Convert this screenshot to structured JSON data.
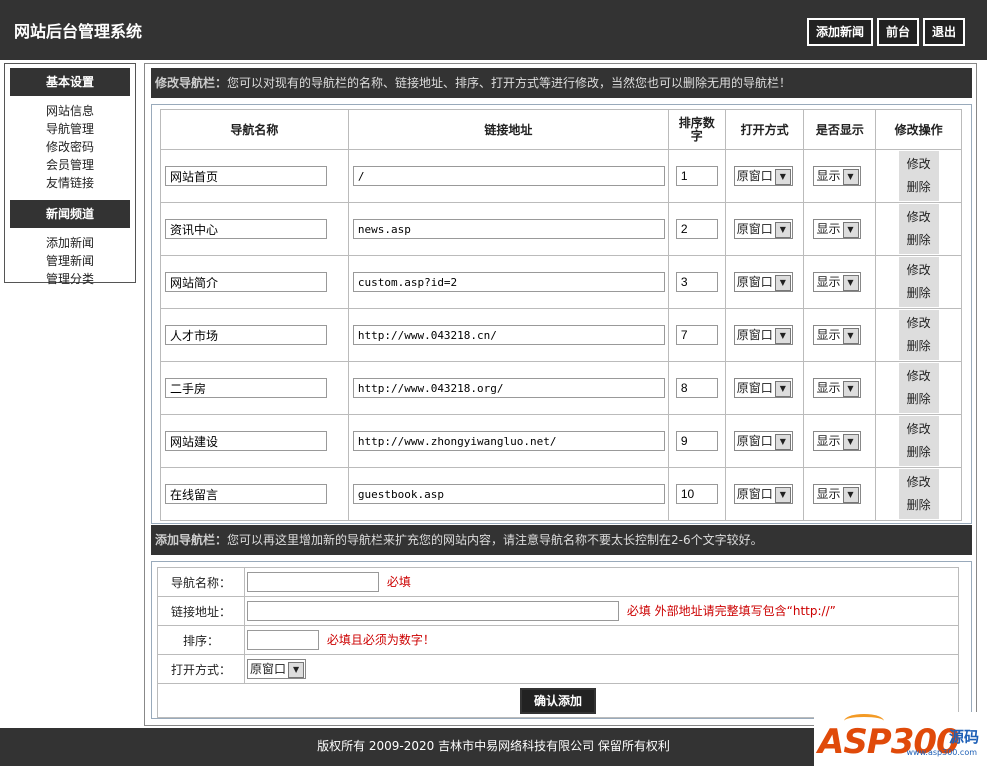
{
  "header": {
    "title": "网站后台管理系统",
    "buttons": [
      "添加新闻",
      "前台",
      "退出"
    ]
  },
  "sidebar": {
    "sections": [
      {
        "title": "基本设置",
        "items": [
          "网站信息",
          "导航管理",
          "修改密码",
          "会员管理",
          "友情链接"
        ]
      },
      {
        "title": "新闻频道",
        "items": [
          "添加新闻",
          "管理新闻",
          "管理分类"
        ]
      }
    ]
  },
  "edit_bar": {
    "label": "修改导航栏：",
    "text": "您可以对现有的导航栏的名称、链接地址、排序、打开方式等进行修改，当然您也可以删除无用的导航栏！"
  },
  "nav_table": {
    "headers": [
      "导航名称",
      "链接地址",
      "排序数字",
      "打开方式",
      "是否显示",
      "修改操作"
    ],
    "rows": [
      {
        "name": "网站首页",
        "url": "/",
        "order": "1",
        "open": "原窗口",
        "show": "显示"
      },
      {
        "name": "资讯中心",
        "url": "news.asp",
        "order": "2",
        "open": "原窗口",
        "show": "显示"
      },
      {
        "name": "网站简介",
        "url": "custom.asp?id=2",
        "order": "3",
        "open": "原窗口",
        "show": "显示"
      },
      {
        "name": "人才市场",
        "url": "http://www.043218.cn/",
        "order": "7",
        "open": "原窗口",
        "show": "显示"
      },
      {
        "name": "二手房",
        "url": "http://www.043218.org/",
        "order": "8",
        "open": "原窗口",
        "show": "显示"
      },
      {
        "name": "网站建设",
        "url": "http://www.zhongyiwangluo.net/",
        "order": "9",
        "open": "原窗口",
        "show": "显示"
      },
      {
        "name": "在线留言",
        "url": "guestbook.asp",
        "order": "10",
        "open": "原窗口",
        "show": "显示"
      }
    ],
    "edit_label": "修改",
    "delete_label": "删除"
  },
  "add_bar": {
    "label": "添加导航栏：",
    "text": "您可以再这里增加新的导航栏来扩充您的网站内容，请注意导航名称不要太长控制在2-6个文字较好。"
  },
  "add_form": {
    "name_label": "导航名称：",
    "name_hint": "必填",
    "url_label": "链接地址：",
    "url_hint": "必填 外部地址请完整填写包含“http://”",
    "order_label": "排序：",
    "order_hint": "必填且必须为数字！",
    "open_label": "打开方式：",
    "open_value": "原窗口",
    "submit_label": "确认添加"
  },
  "footer": {
    "text": "版权所有 2009-2020 吉林市中易网络科技有限公司 保留所有权利"
  },
  "watermark": {
    "brand": "ASP300",
    "tag": "源码",
    "site": "www.asp300.com"
  },
  "colors": {
    "dark": "#333333",
    "required": "#cc0000",
    "watermark_orange": "#e04a0a",
    "watermark_blue": "#1d5fb6"
  }
}
